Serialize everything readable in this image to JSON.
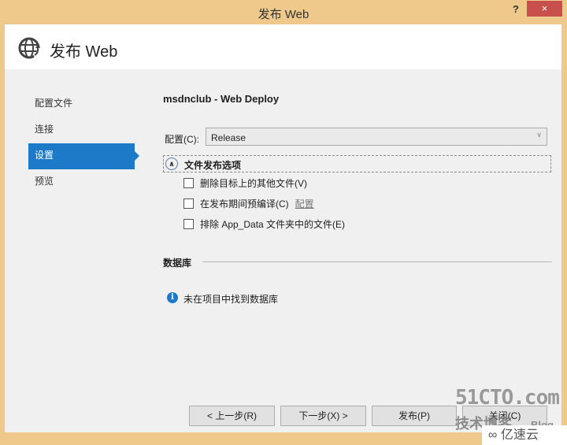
{
  "window": {
    "title": "发布 Web",
    "help_label": "?",
    "close_label": "×"
  },
  "header": {
    "title": "发布 Web",
    "icon": "globe-publish-icon"
  },
  "nav": {
    "items": [
      {
        "label": "配置文件"
      },
      {
        "label": "连接"
      },
      {
        "label": "设置",
        "active": true
      },
      {
        "label": "预览"
      }
    ]
  },
  "main": {
    "profile_title": "msdnclub - Web Deploy",
    "config_label": "配置(C):",
    "config_value": "Release",
    "section_title": "文件发布选项",
    "options": [
      {
        "label": "删除目标上的其他文件(V)",
        "checked": false
      },
      {
        "label": "在发布期间预编译(C)",
        "checked": false,
        "link": "配置"
      },
      {
        "label": "排除 App_Data 文件夹中的文件(E)",
        "checked": false
      }
    ],
    "database_title": "数据库",
    "database_info": "未在项目中找到数据库"
  },
  "footer": {
    "prev": "< 上一步(R)",
    "next": "下一步(X) >",
    "publish": "发布(P)",
    "close": "关闭(C)"
  },
  "watermark": {
    "site": "51CTO.com",
    "tagline": "技术博客",
    "blog": "Blog",
    "brand": "亿速云"
  },
  "colors": {
    "accent": "#1c7ac9",
    "frame": "#efc88c",
    "close": "#c7504c"
  }
}
